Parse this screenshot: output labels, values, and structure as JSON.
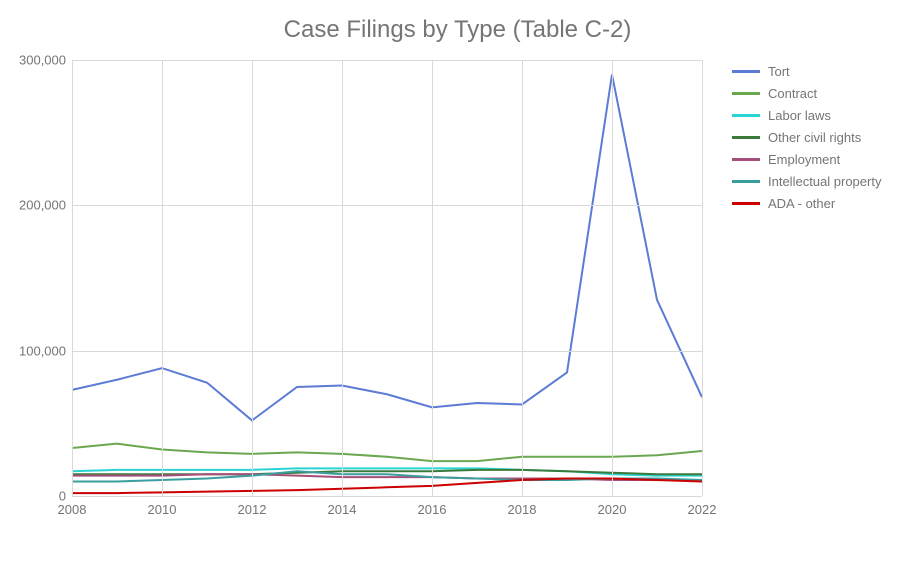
{
  "chart_data": {
    "type": "line",
    "title": "Case Filings by Type (Table C-2)",
    "xlabel": "",
    "ylabel": "",
    "x": [
      2008,
      2009,
      2010,
      2011,
      2012,
      2013,
      2014,
      2015,
      2016,
      2017,
      2018,
      2019,
      2020,
      2021,
      2022
    ],
    "x_ticks": [
      2008,
      2010,
      2012,
      2014,
      2016,
      2018,
      2020,
      2022
    ],
    "y_ticks": [
      0,
      100000,
      200000,
      300000
    ],
    "y_tick_labels": [
      "0",
      "100,000",
      "200,000",
      "300,000"
    ],
    "ylim": [
      0,
      300000
    ],
    "xlim": [
      2008,
      2022
    ],
    "legend_position": "right",
    "grid": true,
    "series": [
      {
        "name": "Tort",
        "color": "#5b7bd5",
        "values": [
          73000,
          80000,
          88000,
          78000,
          52000,
          75000,
          76000,
          70000,
          61000,
          64000,
          63000,
          85000,
          290000,
          135000,
          68000
        ]
      },
      {
        "name": "Contract",
        "color": "#6aa84f",
        "values": [
          33000,
          36000,
          32000,
          30000,
          29000,
          30000,
          29000,
          27000,
          24000,
          24000,
          27000,
          27000,
          27000,
          28000,
          31000
        ]
      },
      {
        "name": "Labor laws",
        "color": "#2bd4d4",
        "values": [
          17000,
          18000,
          18000,
          18000,
          18000,
          19000,
          19000,
          19000,
          19000,
          19000,
          18000,
          17000,
          15000,
          14000,
          14000
        ]
      },
      {
        "name": "Other civil rights",
        "color": "#3b7a3b",
        "values": [
          15000,
          15000,
          15000,
          15000,
          15000,
          16000,
          17000,
          17000,
          17000,
          18000,
          18000,
          17000,
          16000,
          15000,
          15000
        ]
      },
      {
        "name": "Employment",
        "color": "#a64d79",
        "values": [
          14000,
          14000,
          14000,
          15000,
          15000,
          14000,
          13000,
          13000,
          13000,
          12000,
          12000,
          12000,
          11000,
          11000,
          11000
        ]
      },
      {
        "name": "Intellectual property",
        "color": "#3b9e9e",
        "values": [
          10000,
          10000,
          11000,
          12000,
          14000,
          17000,
          15000,
          15000,
          13000,
          12000,
          11000,
          11000,
          12000,
          12000,
          11000
        ]
      },
      {
        "name": "ADA - other",
        "color": "#cc0000",
        "values": [
          2000,
          2000,
          2500,
          3000,
          3500,
          4000,
          5000,
          6000,
          7000,
          9000,
          11000,
          12000,
          12000,
          11000,
          10000
        ]
      }
    ]
  }
}
